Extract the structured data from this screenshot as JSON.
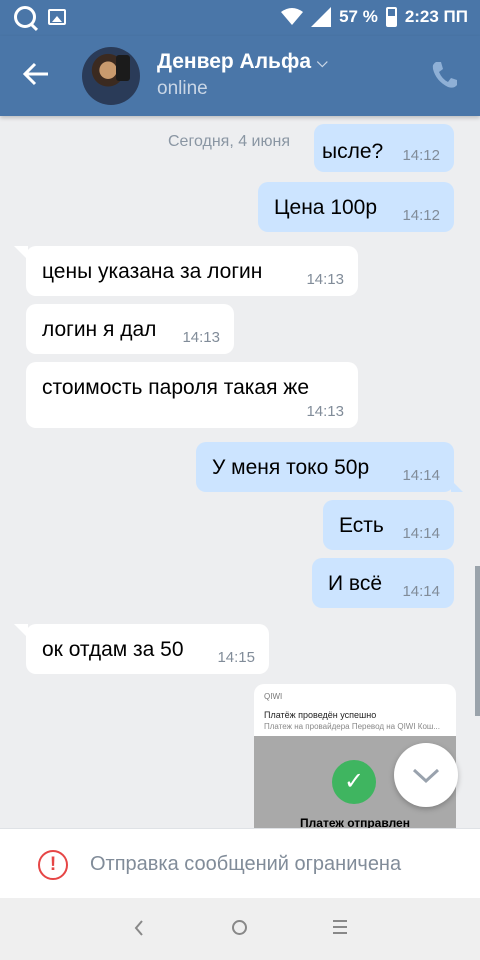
{
  "status_bar": {
    "battery": "57 %",
    "time": "2:23 ПП"
  },
  "header": {
    "contact_name": "Денвер Альфа",
    "status": "online"
  },
  "chat": {
    "date": "Сегодня, 4 июня",
    "messages": [
      {
        "text": "ысле?",
        "time": "14:12"
      },
      {
        "text": "Цена 100р",
        "time": "14:12"
      },
      {
        "text": "цены указана за логин",
        "time": "14:13"
      },
      {
        "text": "логин я дал",
        "time": "14:13"
      },
      {
        "text": "стоимость пароля такая же",
        "time": "14:13"
      },
      {
        "text": "У меня токо 50р",
        "time": "14:14"
      },
      {
        "text": "Есть",
        "time": "14:14"
      },
      {
        "text": "И всё",
        "time": "14:14"
      },
      {
        "text": "ок отдам за 50",
        "time": "14:15"
      }
    ],
    "receipt": {
      "brand": "QIWI",
      "title": "Платёж проведён успешно",
      "subtitle": "Платеж на провайдера Перевод на QIWI Кош...",
      "sent": "Платеж отправлен"
    }
  },
  "composer": {
    "restricted_text": "Отправка сообщений ограничена"
  },
  "colors": {
    "header": "#4a76a8",
    "outgoing": "#cce4ff",
    "incoming": "#ffffff",
    "warning": "#e64646"
  }
}
